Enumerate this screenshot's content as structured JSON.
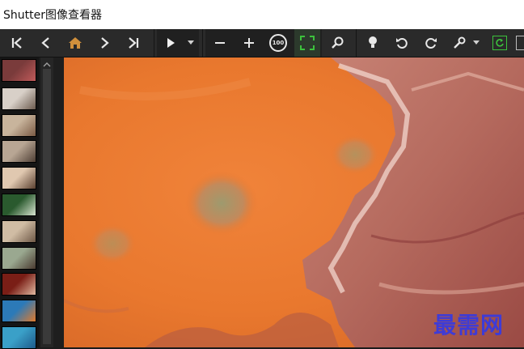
{
  "window": {
    "title": "Shutter图像查看器"
  },
  "toolbar": {
    "buttons": [
      {
        "name": "first-image-button",
        "icon": "first-icon"
      },
      {
        "name": "previous-image-button",
        "icon": "chevron-left-icon"
      },
      {
        "name": "home-button",
        "icon": "home-icon",
        "color": "#d0903c"
      },
      {
        "name": "next-image-button",
        "icon": "chevron-right-icon"
      },
      {
        "name": "last-image-button",
        "icon": "last-icon"
      },
      {
        "name": "slideshow-play-button",
        "icon": "play-icon"
      },
      {
        "name": "slideshow-dropdown-button",
        "icon": "caret-down-icon"
      },
      {
        "name": "zoom-out-button",
        "icon": "minus-icon"
      },
      {
        "name": "zoom-in-button",
        "icon": "plus-icon"
      },
      {
        "name": "actual-size-button",
        "icon": "actual-size-icon"
      },
      {
        "name": "fit-to-window-button",
        "icon": "fit-screen-icon",
        "color": "#3cc23c"
      },
      {
        "name": "zoom-magnifier-button",
        "icon": "magnifier-icon"
      },
      {
        "name": "bulb-button",
        "icon": "bulb-icon"
      },
      {
        "name": "rotate-left-button",
        "icon": "rotate-left-icon"
      },
      {
        "name": "rotate-right-button",
        "icon": "rotate-right-icon"
      },
      {
        "name": "tools-button",
        "icon": "wrench-icon"
      },
      {
        "name": "tools-dropdown-button",
        "icon": "caret-down-icon"
      },
      {
        "name": "refresh-button",
        "icon": "refresh-icon",
        "color": "#3cc23c"
      },
      {
        "name": "next-panel-button",
        "icon": "panel-icon"
      }
    ],
    "zoom_label": "100"
  },
  "thumbnails": [
    {
      "name": "thumbnail-top-partial",
      "colors": [
        "#7a3b3b",
        "#c05a5a"
      ]
    },
    {
      "name": "thumbnail-child-1",
      "colors": [
        "#d8d0c8",
        "#6b5a4e"
      ]
    },
    {
      "name": "thumbnail-child-2",
      "colors": [
        "#c8b49c",
        "#7a5a44"
      ]
    },
    {
      "name": "thumbnail-child-3",
      "colors": [
        "#b8a694",
        "#4e3e34"
      ]
    },
    {
      "name": "thumbnail-child-4",
      "colors": [
        "#e0c8b0",
        "#5a4030"
      ]
    },
    {
      "name": "thumbnail-child-5",
      "colors": [
        "#2a5a2e",
        "#d8e4d0"
      ]
    },
    {
      "name": "thumbnail-child-6",
      "colors": [
        "#d0bca4",
        "#6e5846"
      ]
    },
    {
      "name": "thumbnail-child-7",
      "colors": [
        "#9aa890",
        "#4a3a30"
      ]
    },
    {
      "name": "thumbnail-child-8",
      "colors": [
        "#7a1e16",
        "#e0b8a0"
      ]
    },
    {
      "name": "thumbnail-landscape-1",
      "colors": [
        "#2c7ab8",
        "#e07a2c"
      ]
    },
    {
      "name": "thumbnail-landscape-2",
      "colors": [
        "#3aa0c8",
        "#1e5a8a"
      ]
    }
  ],
  "watermark": "最需网",
  "colors": {
    "accent_green": "#3cc23c",
    "home_orange": "#d0903c",
    "watermark_blue": "#3e3bd6"
  }
}
